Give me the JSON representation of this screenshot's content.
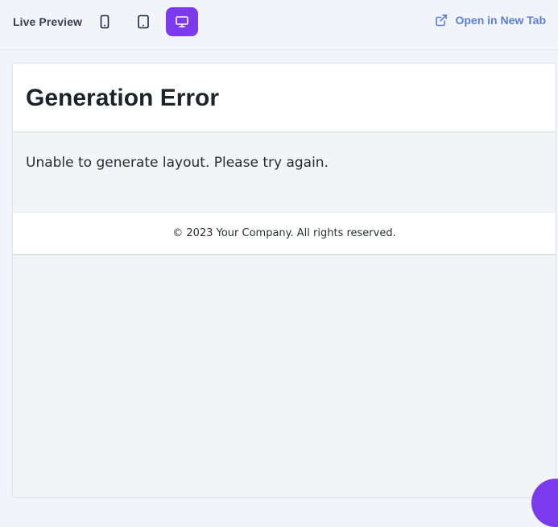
{
  "toolbar": {
    "title": "Live Preview",
    "devices": [
      {
        "name": "mobile",
        "icon": "smartphone-icon",
        "active": false
      },
      {
        "name": "tablet",
        "icon": "tablet-icon",
        "active": false
      },
      {
        "name": "desktop",
        "icon": "monitor-icon",
        "active": true
      }
    ],
    "open_new_tab_label": "Open in New Tab",
    "open_new_tab_icon": "external-link-icon"
  },
  "preview": {
    "heading": "Generation Error",
    "message": "Unable to generate layout. Please try again.",
    "footer": "© 2023 Your Company. All rights reserved."
  },
  "colors": {
    "accent": "#7c3aed",
    "link": "#5b7fd6",
    "toolbar_bg": "#f1f4f9",
    "preview_bg": "#f3f4f6"
  },
  "fab": {
    "icon": "action-button-icon"
  }
}
